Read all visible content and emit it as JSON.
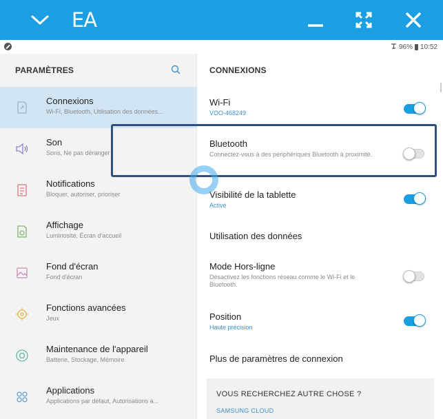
{
  "titlebar": {
    "logo_text": "EA",
    "icons": [
      "chevron-down-icon",
      "ea-logo",
      "minimize-icon",
      "expand-icon",
      "close-icon"
    ]
  },
  "status_bar": {
    "battery": "96%",
    "time": "10:52"
  },
  "sidebar": {
    "title": "PARAMÈTRES",
    "items": [
      {
        "title": "Connexions",
        "subtitle": "Wi-Fi, Bluetooth, Utilisation des données...",
        "icon": "connections-icon",
        "active": true
      },
      {
        "title": "Son",
        "subtitle": "Sons, Ne pas déranger",
        "icon": "sound-icon",
        "active": false
      },
      {
        "title": "Notifications",
        "subtitle": "Bloquer, autoriser, prioriser",
        "icon": "notifications-icon",
        "active": false
      },
      {
        "title": "Affichage",
        "subtitle": "Luminosité, Écran d'accueil",
        "icon": "display-icon",
        "active": false
      },
      {
        "title": "Fond d'écran",
        "subtitle": "Fond d'écran",
        "icon": "wallpaper-icon",
        "active": false
      },
      {
        "title": "Fonctions avancées",
        "subtitle": "Jeux",
        "icon": "advanced-features-icon",
        "active": false
      },
      {
        "title": "Maintenance de l'appareil",
        "subtitle": "Batterie, Stockage, Mémoire",
        "icon": "device-maintenance-icon",
        "active": false
      },
      {
        "title": "Applications",
        "subtitle": "Applications par défaut, Autorisations a...",
        "icon": "applications-icon",
        "active": false
      }
    ]
  },
  "content": {
    "title": "CONNEXIONS",
    "settings": [
      {
        "title": "Wi-Fi",
        "subtitle": "VOO-468249",
        "subtitle_blue": true,
        "toggle": true
      },
      {
        "title": "Bluetooth",
        "subtitle": "Connectez-vous à des périphériques Bluetooth à proximité.",
        "subtitle_blue": false,
        "toggle": false
      },
      {
        "title": "Visibilité de la tablette",
        "subtitle": "Activé",
        "subtitle_blue": true,
        "toggle": true
      },
      {
        "title": "Utilisation des données",
        "subtitle": "",
        "subtitle_blue": false,
        "toggle": null
      },
      {
        "title": "Mode Hors-ligne",
        "subtitle": "Désactivez les fonctions réseau comme le Wi-Fi et le Bluetooth.",
        "subtitle_blue": false,
        "toggle": false
      },
      {
        "title": "Position",
        "subtitle": "Haute précision",
        "subtitle_blue": true,
        "toggle": true
      },
      {
        "title": "Plus de paramètres de connexion",
        "subtitle": "",
        "subtitle_blue": false,
        "toggle": null
      }
    ],
    "search_card": {
      "title": "VOUS RECHERCHEZ AUTRE CHOSE ?",
      "link": "SAMSUNG CLOUD"
    }
  },
  "colors": {
    "accent": "#1c9ee3",
    "active_item_bg": "#d1e5f5",
    "highlight_box": "#2f4f7f",
    "link_blue": "#3b8ed0"
  }
}
